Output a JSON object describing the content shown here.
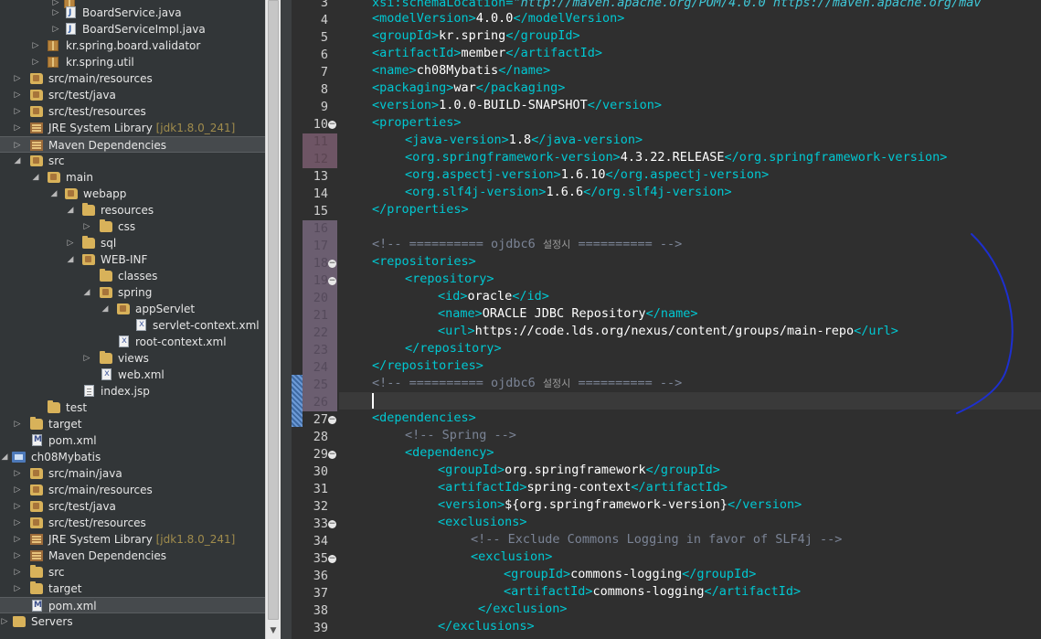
{
  "explorer": {
    "rows": [
      {
        "label": "",
        "indent": 3
      },
      {
        "label": "BoardService.java",
        "icon": "java"
      },
      {
        "label": "BoardServiceImpl.java",
        "icon": "java"
      },
      {
        "label": "kr.spring.board.validator",
        "icon": "package"
      },
      {
        "label": "kr.spring.util",
        "icon": "package"
      },
      {
        "label": "src/main/resources",
        "icon": "source-folder"
      },
      {
        "label": "src/test/java",
        "icon": "source-folder"
      },
      {
        "label": "src/test/resources",
        "icon": "source-folder"
      },
      {
        "label": "JRE System Library",
        "decoration": "[jdk1.8.0_241]",
        "icon": "library"
      },
      {
        "label": "Maven Dependencies",
        "icon": "library"
      },
      {
        "label": "src",
        "icon": "folder"
      },
      {
        "label": "main",
        "icon": "folder"
      },
      {
        "label": "webapp",
        "icon": "folder"
      },
      {
        "label": "resources",
        "icon": "folder"
      },
      {
        "label": "css",
        "icon": "folder"
      },
      {
        "label": "sql",
        "icon": "folder"
      },
      {
        "label": "WEB-INF",
        "icon": "folder"
      },
      {
        "label": "classes",
        "icon": "folder"
      },
      {
        "label": "spring",
        "icon": "folder"
      },
      {
        "label": "appServlet",
        "icon": "folder"
      },
      {
        "label": "servlet-context.xml",
        "icon": "xml-file"
      },
      {
        "label": "root-context.xml",
        "icon": "xml-file"
      },
      {
        "label": "views",
        "icon": "folder"
      },
      {
        "label": "web.xml",
        "icon": "xml-file"
      },
      {
        "label": "index.jsp",
        "icon": "jsp-file"
      },
      {
        "label": "test",
        "icon": "folder"
      },
      {
        "label": "target",
        "icon": "folder"
      },
      {
        "label": "pom.xml",
        "icon": "pom-file"
      },
      {
        "label": "ch08Mybatis",
        "icon": "project"
      },
      {
        "label": "src/main/java",
        "icon": "source-folder"
      },
      {
        "label": "src/main/resources",
        "icon": "source-folder"
      },
      {
        "label": "src/test/java",
        "icon": "source-folder"
      },
      {
        "label": "src/test/resources",
        "icon": "source-folder"
      },
      {
        "label": "JRE System Library",
        "decoration": "[jdk1.8.0_241]",
        "icon": "library"
      },
      {
        "label": "Maven Dependencies",
        "icon": "library"
      },
      {
        "label": "src",
        "icon": "folder"
      },
      {
        "label": "target",
        "icon": "folder"
      },
      {
        "label": "pom.xml",
        "icon": "pom-file"
      },
      {
        "label": "Servers",
        "icon": "servers-folder"
      }
    ]
  },
  "editor": {
    "line_numbers": [
      "3",
      "4",
      "5",
      "6",
      "7",
      "8",
      "9",
      "10",
      "11",
      "12",
      "13",
      "14",
      "15",
      "16",
      "17",
      "18",
      "19",
      "20",
      "21",
      "22",
      "23",
      "24",
      "25",
      "26",
      "27",
      "28",
      "29",
      "30",
      "31",
      "32",
      "33",
      "34",
      "35",
      "36",
      "37",
      "38",
      "39"
    ],
    "lines": {
      "l3": {
        "attr": "xsi:schemaLocation=",
        "url": "\"http://maven.apache.org/POM/4.0.0 https://maven.apache.org/mav"
      },
      "l4": {
        "open": "<modelVersion>",
        "value": "4.0.0",
        "close": "</modelVersion>"
      },
      "l5": {
        "open": "<groupId>",
        "value": "kr.spring",
        "close": "</groupId>"
      },
      "l6": {
        "open": "<artifactId>",
        "value": "member",
        "close": "</artifactId>"
      },
      "l7": {
        "open": "<name>",
        "value": "ch08Mybatis",
        "close": "</name>"
      },
      "l8": {
        "open": "<packaging>",
        "value": "war",
        "close": "</packaging>"
      },
      "l9": {
        "open": "<version>",
        "value": "1.0.0-BUILD-SNAPSHOT",
        "close": "</version>"
      },
      "l10": {
        "open": "<properties>"
      },
      "l11": {
        "open": "<java-version>",
        "value": "1.8",
        "close": "</java-version>"
      },
      "l12": {
        "open": "<org.springframework-version>",
        "value": "4.3.22.RELEASE",
        "close": "</org.springframework-version>"
      },
      "l13": {
        "open": "<org.aspectj-version>",
        "value": "1.6.10",
        "close": "</org.aspectj-version>"
      },
      "l14": {
        "open": "<org.slf4j-version>",
        "value": "1.6.6",
        "close": "</org.slf4j-version>"
      },
      "l15": {
        "close": "</properties>"
      },
      "l17": {
        "c1": "<!-- ========== ojdbc6 ",
        "korean": "설정시",
        "c2": " ========== -->"
      },
      "l18": {
        "open": "<repositories>"
      },
      "l19": {
        "open": "<repository>"
      },
      "l20": {
        "open": "<id>",
        "value": "oracle",
        "close": "</id>"
      },
      "l21": {
        "open": "<name>",
        "value": "ORACLE JDBC Repository",
        "close": "</name>"
      },
      "l22": {
        "open": "<url>",
        "value": "https://code.lds.org/nexus/content/groups/main-repo",
        "close": "</url>"
      },
      "l23": {
        "close": "</repository>"
      },
      "l24": {
        "close": "</repositories>"
      },
      "l25": {
        "c1": "<!-- ========== ojdbc6 ",
        "korean": "설정시",
        "c2": " ========== -->"
      },
      "l27": {
        "open": "<dependencies>"
      },
      "l28": {
        "comment": "<!-- Spring -->"
      },
      "l29": {
        "open": "<dependency>"
      },
      "l30": {
        "open": "<groupId>",
        "value": "org.springframework",
        "close": "</groupId>"
      },
      "l31": {
        "open": "<artifactId>",
        "value": "spring-context",
        "close": "</artifactId>"
      },
      "l32": {
        "open": "<version>",
        "value": "${org.springframework-version}",
        "close": "</version>"
      },
      "l33": {
        "open": "<exclusions>"
      },
      "l34": {
        "comment": "<!-- Exclude Commons Logging in favor of SLF4j -->"
      },
      "l35": {
        "open": "<exclusion>"
      },
      "l36": {
        "open": "<groupId>",
        "value": "commons-logging",
        "close": "</groupId>"
      },
      "l37": {
        "open": "<artifactId>",
        "value": "commons-logging",
        "close": "</artifactId>"
      },
      "l38": {
        "close": "</exclusion>"
      },
      "l39": {
        "close": "</exclusions>"
      }
    }
  },
  "colors": {
    "tag": "#00c8d2",
    "tag_bracket": "#3c9bd6",
    "comment": "#7b8496",
    "annotation_stroke": "#1d2fd0"
  }
}
